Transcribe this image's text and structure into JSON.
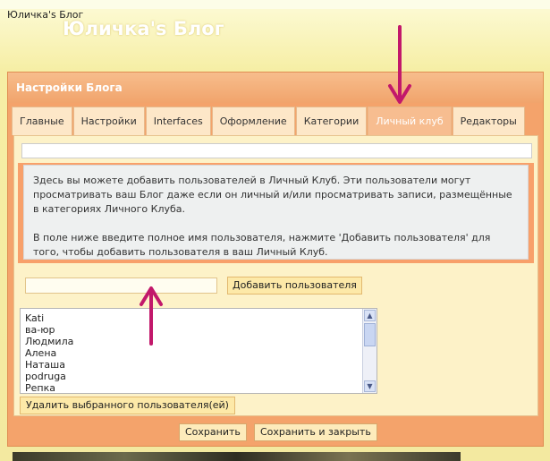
{
  "browser": {
    "title": "Юличка's Блог"
  },
  "blog": {
    "title": "Юличка's Блог"
  },
  "dialog": {
    "title": "Настройки Блога",
    "tabs": [
      {
        "label": "Главные",
        "active": false
      },
      {
        "label": "Настройки",
        "active": false
      },
      {
        "label": "Interfaces",
        "active": false
      },
      {
        "label": "Оформление",
        "active": false
      },
      {
        "label": "Категории",
        "active": false
      },
      {
        "label": "Личный клуб",
        "active": true
      },
      {
        "label": "Редакторы",
        "active": false
      }
    ],
    "info": {
      "paragraph1": "Здесь вы можете добавить пользователей в Личный Клуб. Эти пользователи могут просматривать ваш Блог даже если он личный и/или просматривать записи, размещённые в категориях Личного Клуба.",
      "paragraph2": "В поле ниже введите полное имя пользователя, нажмите 'Добавить пользователя' для того, чтобы добавить пользователя в ваш Личный Клуб."
    },
    "add_input": {
      "value": "",
      "placeholder": ""
    },
    "add_button": "Добавить пользователя",
    "users": [
      "Kati",
      "ва-юр",
      "Людмила",
      "Алена",
      "Наташа",
      "podruga",
      "Репка"
    ],
    "delete_button": "Удалить выбранного пользователя(ей)",
    "save_button": "Сохранить",
    "save_close_button": "Сохранить и закрыть"
  },
  "colors": {
    "dialog_border": "#f4a36b",
    "panel_bg": "#fdf2c8",
    "arrow": "#c2186b"
  },
  "icons": {
    "scroll_up": "chevron-up-icon",
    "scroll_down": "chevron-down-icon",
    "annotation_down": "arrow-down-icon",
    "annotation_up": "arrow-up-icon"
  }
}
